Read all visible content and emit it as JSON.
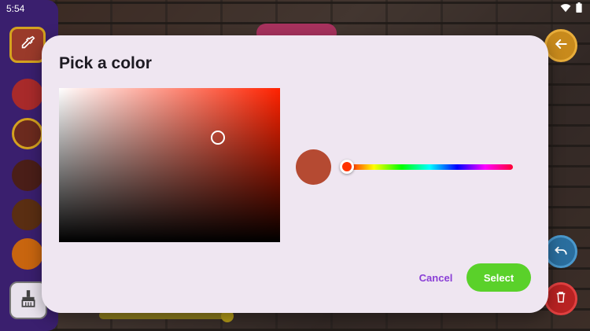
{
  "status": {
    "time": "5:54"
  },
  "dialog": {
    "title": "Pick a color",
    "cancel_label": "Cancel",
    "select_label": "Select",
    "selected_color": "#b54a32",
    "picker_hue": "#ff2200",
    "hue_thumb_color": "#ff3300"
  },
  "palette": {
    "active_color": "#9a3a2a",
    "swatches": [
      "#a82a2a",
      "#6b2a1e",
      "#4a1e18",
      "#5a2e12",
      "#c8650f"
    ]
  },
  "colors": {
    "accent_purple": "#8a3fd6",
    "select_green": "#5ad12a",
    "dialog_bg": "#efe6f1"
  },
  "icons": [
    "eyedropper-icon",
    "brush-icon",
    "back-arrow-icon",
    "undo-icon",
    "trash-icon",
    "wifi-icon",
    "battery-icon"
  ]
}
